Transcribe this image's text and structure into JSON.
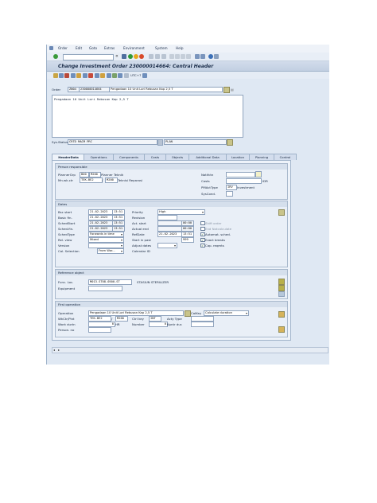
{
  "menu": [
    "Order",
    "Edit",
    "Goto",
    "Extras",
    "Environment",
    "System",
    "Help"
  ],
  "window_title": "Change Investment Order 230000014664: Central Header",
  "header": {
    "order_label": "Order",
    "order_type": "ZN04",
    "order_number": "230000014664",
    "order_text": "Pengadaan 10 Unit Lori Rebusan Kap 2,5 T",
    "long_text": "Pengadaan 10 Unit Lori Rebusan Kap 2,5 T",
    "sys_status_label": "Sys.Status",
    "sys_status": "CRTD MACM PRC",
    "user_status": "PLAN",
    "timezone": "UTC+7"
  },
  "tabs": [
    "HeaderData",
    "Operations",
    "Components",
    "Costs",
    "Objects",
    "Additional Data",
    "Location",
    "Planning",
    "Control"
  ],
  "person_responsible": {
    "title": "Person responsible",
    "planner_grp_label": "PlannerGrp",
    "planner_grp_a": "B00",
    "planner_grp_b": "M200",
    "planner_grp_text": "Planner Teknik",
    "mn_wk_ctr_label": "Mn.wk.ctr",
    "mn_wk_ctr": "TEK-BE2",
    "mn_wk_ctr_plant": "M200",
    "mn_wk_ctr_text": "Teknisi Reparasi",
    "notifctn_label": "Notifctn",
    "costs_label": "Costs",
    "costs_currency": "IDR",
    "pmact_label": "PMActType",
    "pmact_value": "IRV",
    "pmact_text": "Investment",
    "sysc_label": "SysCond."
  },
  "dates": {
    "title": "Dates",
    "bsc_start_label": "Bsc start",
    "bsc_start": "21.02.2023",
    "bsc_start_time": "13:51",
    "basic_fin_label": "Basic fin.",
    "basic_fin": "21.02.2023",
    "basic_fin_time": "13:51",
    "sched_start_label": "SchedStart",
    "sched_start": "21.02.2023",
    "sched_start_time": "13:51",
    "sched_fin_label": "Sched.fin.",
    "sched_fin": "21.02.2023",
    "sched_fin_time": "13:51",
    "sched_type_label": "SchedType",
    "sched_type": "Forwards in time",
    "rel_view_label": "Rel. view",
    "rel_view": "Mixed",
    "version_label": "Version",
    "cal_selection_label": "Cal. Selection",
    "cal_selection": "From Wor...",
    "priority_label": "Priority",
    "priority": "High",
    "revision_label": "Revision",
    "act_start_label": "Act. start",
    "act_start_time": "00:00",
    "actual_end_label": "Actual end",
    "actual_end_time": "00:00",
    "refdate_label": "RefDate",
    "refdate": "21.02.2023",
    "refdate_time": "13:51",
    "start_in_past_label": "Start in past",
    "start_in_past": "999",
    "adjust_dates_label": "Adjust dates",
    "calendar_id_label": "Calendar ID",
    "shift_order_label": "Shift order",
    "end_nbsc_label": "End Notcalculate",
    "automat_sched_label": "Automat. sched.",
    "exact_breaks_label": "Exact breaks",
    "cap_reqmts_label": "Cap. reqmts"
  },
  "reference_object": {
    "title": "Reference object",
    "func_loc_label": "Func. Loc.",
    "func_loc": "M013-ST08-0500-ST",
    "func_loc_text": "STASIUN STERILIZER",
    "equipment_label": "Equipment"
  },
  "first_operation": {
    "title": "First operation",
    "operation_label": "Operation",
    "operation_text": "Pengadaan 10 Unit Lori Rebusan Kap 2,5 T",
    "wkctr_label": "WkCtr/Pint",
    "wkctr": "TEK-BE2",
    "wkctr_plant": "M200",
    "ctrl_key_label": "Ctrl key",
    "ctrl_key": "INT",
    "acty_type_label": "Acty Type",
    "work_durtn_label": "Work durtn",
    "work_durtn": "0",
    "number_label": "Number",
    "number": "0",
    "opnt_dur_label": "Kpntr dur.",
    "unit": "HR",
    "person_no_label": "Person. no",
    "calc_label": "CalKey",
    "calc_value": "Calculate duration"
  },
  "colors": {
    "title_bar": "#c2cfe2",
    "panel": "#eef3fa",
    "field_border": "#8fa3bd",
    "check_green": "#1a5a1a"
  }
}
